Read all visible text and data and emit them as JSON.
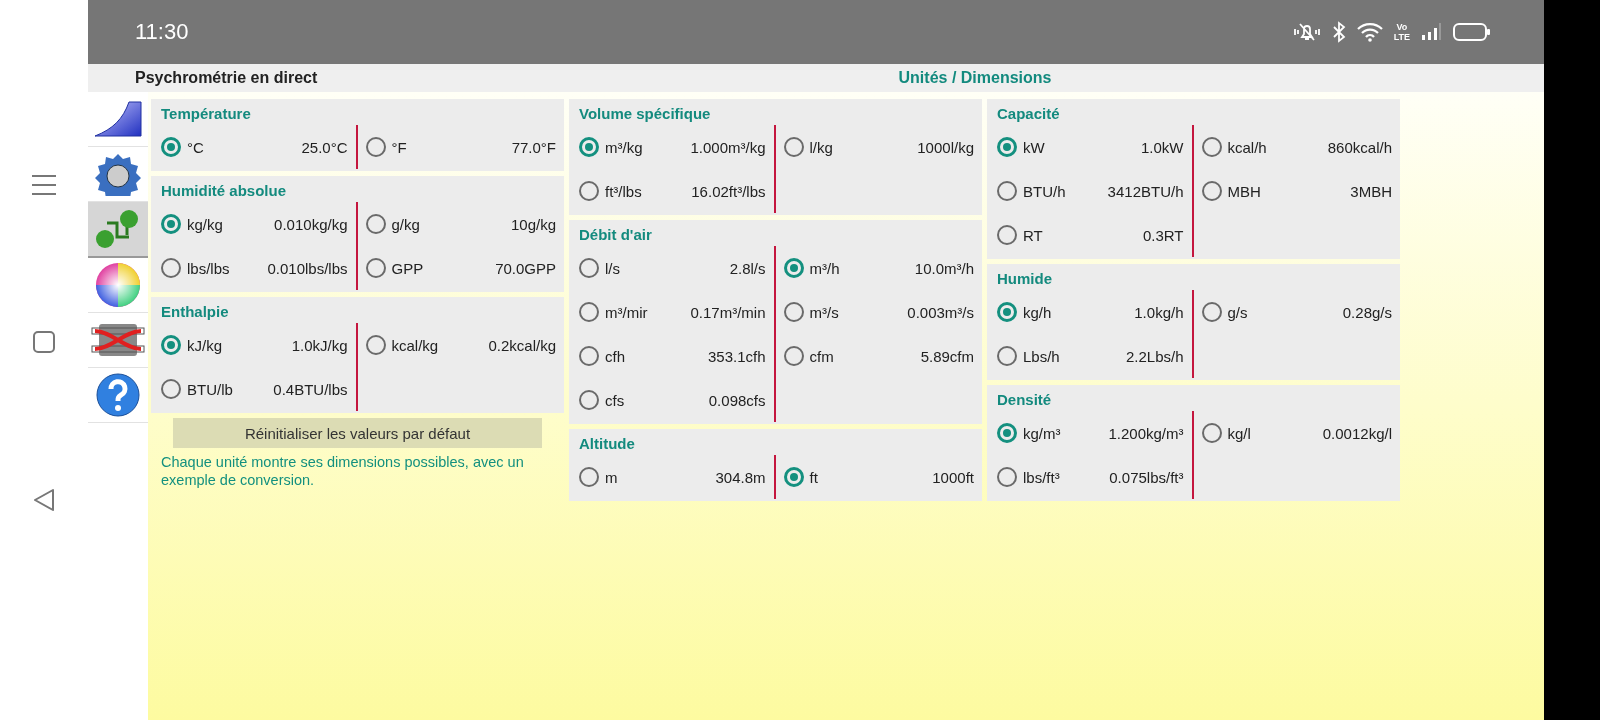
{
  "status_bar": {
    "time": "11:30",
    "network_label": [
      "Vo",
      "LTE"
    ]
  },
  "app_bar": {
    "title": "Psychrométrie en direct",
    "section_title": "Unités / Dimensions"
  },
  "sidebar": {
    "items": [
      {
        "kind": "chart",
        "selected": false
      },
      {
        "kind": "gear",
        "selected": false
      },
      {
        "kind": "swap",
        "selected": true
      },
      {
        "kind": "color",
        "selected": false
      },
      {
        "kind": "exchanger",
        "selected": false
      },
      {
        "kind": "help",
        "selected": false
      }
    ]
  },
  "columns": [
    {
      "groups": [
        {
          "title": "Température",
          "options": [
            {
              "label": "°C",
              "value": "25.0°C",
              "selected": true
            },
            {
              "label": "°F",
              "value": "77.0°F",
              "selected": false
            }
          ]
        },
        {
          "title": "Humidité absolue",
          "options": [
            {
              "label": "kg/kg",
              "value": "0.010kg/kg",
              "selected": true
            },
            {
              "label": "g/kg",
              "value": "10g/kg",
              "selected": false
            },
            {
              "label": "lbs/lbs",
              "value": "0.010lbs/lbs",
              "selected": false
            },
            {
              "label": "GPP",
              "value": "70.0GPP",
              "selected": false
            }
          ]
        },
        {
          "title": "Enthalpie",
          "options": [
            {
              "label": "kJ/kg",
              "value": "1.0kJ/kg",
              "selected": true
            },
            {
              "label": "kcal/kg",
              "value": "0.2kcal/kg",
              "selected": false
            },
            {
              "label": "BTU/lb",
              "value": "0.4BTU/lbs",
              "selected": false
            }
          ]
        }
      ],
      "reset_button": "Réinitialiser les valeurs par défaut",
      "note": "Chaque unité montre ses dimensions possibles, avec un exemple de conversion."
    },
    {
      "groups": [
        {
          "title": "Volume spécifique",
          "options": [
            {
              "label": "m³/kg",
              "value": "1.000m³/kg",
              "selected": true
            },
            {
              "label": "l/kg",
              "value": "1000l/kg",
              "selected": false
            },
            {
              "label": "ft³/lbs",
              "value": "16.02ft³/lbs",
              "selected": false
            }
          ]
        },
        {
          "title": "Débit d'air",
          "options": [
            {
              "label": "l/s",
              "value": "2.8l/s",
              "selected": false
            },
            {
              "label": "m³/h",
              "value": "10.0m³/h",
              "selected": true
            },
            {
              "label": "m³/mir",
              "value": "0.17m³/min",
              "selected": false
            },
            {
              "label": "m³/s",
              "value": "0.003m³/s",
              "selected": false
            },
            {
              "label": "cfh",
              "value": "353.1cfh",
              "selected": false
            },
            {
              "label": "cfm",
              "value": "5.89cfm",
              "selected": false
            },
            {
              "label": "cfs",
              "value": "0.098cfs",
              "selected": false
            }
          ]
        },
        {
          "title": "Altitude",
          "options": [
            {
              "label": "m",
              "value": "304.8m",
              "selected": false
            },
            {
              "label": "ft",
              "value": "1000ft",
              "selected": true
            }
          ]
        }
      ]
    },
    {
      "groups": [
        {
          "title": "Capacité",
          "options": [
            {
              "label": "kW",
              "value": "1.0kW",
              "selected": true
            },
            {
              "label": "kcal/h",
              "value": "860kcal/h",
              "selected": false
            },
            {
              "label": "BTU/h",
              "value": "3412BTU/h",
              "selected": false
            },
            {
              "label": "MBH",
              "value": "3MBH",
              "selected": false
            },
            {
              "label": "RT",
              "value": "0.3RT",
              "selected": false
            }
          ]
        },
        {
          "title": "Humide",
          "options": [
            {
              "label": "kg/h",
              "value": "1.0kg/h",
              "selected": true
            },
            {
              "label": "g/s",
              "value": "0.28g/s",
              "selected": false
            },
            {
              "label": "Lbs/h",
              "value": "2.2Lbs/h",
              "selected": false
            }
          ]
        },
        {
          "title": "Densité",
          "options": [
            {
              "label": "kg/m³",
              "value": "1.200kg/m³",
              "selected": true
            },
            {
              "label": "kg/l",
              "value": "0.0012kg/l",
              "selected": false
            },
            {
              "label": "lbs/ft³",
              "value": "0.075lbs/ft³",
              "selected": false
            }
          ]
        }
      ]
    }
  ]
}
